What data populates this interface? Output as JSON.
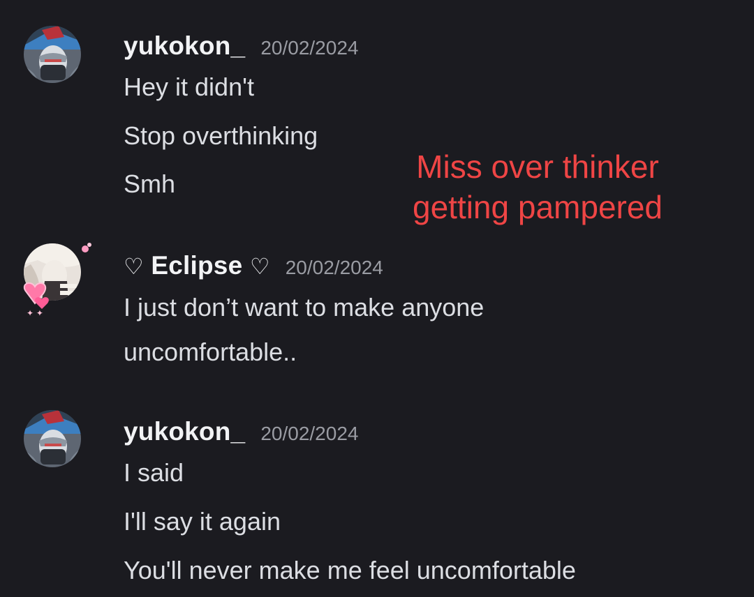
{
  "messages": [
    {
      "username": "yukokon_",
      "timestamp": "20/02/2024",
      "lines": [
        "Hey it didn't",
        "Stop overthinking",
        "Smh"
      ]
    },
    {
      "username_prefix": "♡",
      "username": "Eclipse",
      "username_suffix": "♡",
      "timestamp": "20/02/2024",
      "lines": [
        "I just don’t want to make anyone",
        "uncomfortable.."
      ]
    },
    {
      "username": "yukokon_",
      "timestamp": "20/02/2024",
      "lines": [
        "I said",
        "I'll say it again",
        "You'll never make me feel uncomfortable"
      ]
    }
  ],
  "annotation": {
    "line1": "Miss over thinker",
    "line2": "getting pampered",
    "color": "#ef4545"
  },
  "colors": {
    "background": "#1b1b20",
    "username": "#f2f3f5",
    "timestamp": "#9a9ca3",
    "message_text": "#dcdee3"
  }
}
